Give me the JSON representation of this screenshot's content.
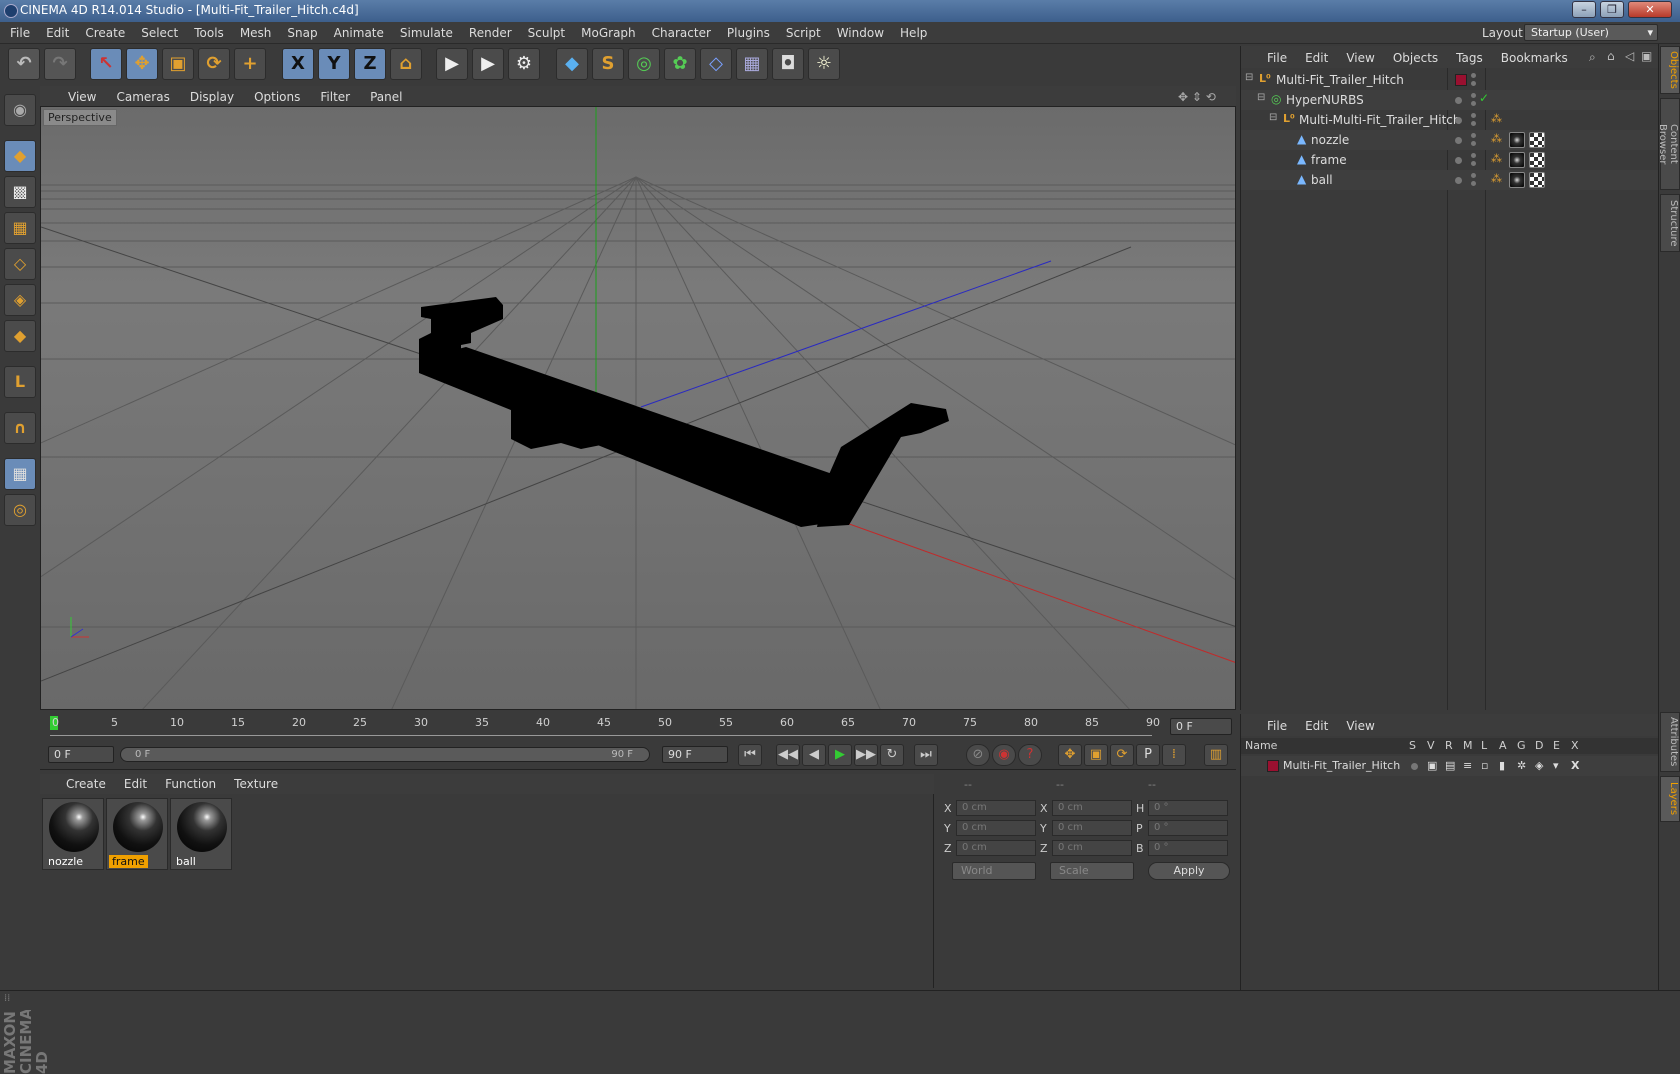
{
  "window": {
    "title": "CINEMA 4D R14.014 Studio - [Multi-Fit_Trailer_Hitch.c4d]",
    "min": "–",
    "max": "❐",
    "close": "✕"
  },
  "menubar": {
    "items": [
      "File",
      "Edit",
      "Create",
      "Select",
      "Tools",
      "Mesh",
      "Snap",
      "Animate",
      "Simulate",
      "Render",
      "Sculpt",
      "MoGraph",
      "Character",
      "Plugins",
      "Script",
      "Window",
      "Help"
    ],
    "layout_label": "Layout:",
    "layout_value": "Startup (User)"
  },
  "toolbar": {
    "undo": "↶",
    "redo": "↷",
    "live_select": "↖",
    "move": "✥",
    "scale": "▣",
    "rotate": "⟳",
    "last_tool": "+",
    "x_axis": "X",
    "y_axis": "Y",
    "z_axis": "Z",
    "coord_system": "⌂",
    "render_view": "▶",
    "render_pic": "▶",
    "render_settings": "⚙",
    "cube": "◆",
    "spline": "S",
    "nurbs": "◎",
    "array": "✿",
    "deformer": "◇",
    "floor": "▦",
    "camera": "◘",
    "light": "☼"
  },
  "lefttools": {
    "items": [
      "◉",
      "◆",
      "▩",
      "▦",
      "◇",
      "◈",
      "◆",
      "L",
      "∩",
      "▦",
      "◎"
    ]
  },
  "viewport": {
    "menu": [
      "View",
      "Cameras",
      "Display",
      "Options",
      "Filter",
      "Panel"
    ],
    "label": "Perspective"
  },
  "timeline": {
    "ticks": [
      "0",
      "5",
      "10",
      "15",
      "20",
      "25",
      "30",
      "35",
      "40",
      "45",
      "50",
      "55",
      "60",
      "65",
      "70",
      "75",
      "80",
      "85",
      "90"
    ],
    "current_frame": "0 F"
  },
  "transport": {
    "start_field": "0 F",
    "range_start": "0 F",
    "range_end": "90 F",
    "end_field": "90 F",
    "buttons": [
      "⏮",
      "◀◀",
      "◀",
      "▶",
      "▶▶",
      "↻",
      "⏭"
    ]
  },
  "materials": {
    "menu": [
      "Create",
      "Edit",
      "Function",
      "Texture"
    ],
    "items": [
      {
        "name": "nozzle",
        "selected": false
      },
      {
        "name": "frame",
        "selected": true
      },
      {
        "name": "ball",
        "selected": false
      }
    ]
  },
  "coords": {
    "headers": [
      "--",
      "--",
      "--"
    ],
    "rows": [
      {
        "a": "X",
        "av": "0 cm",
        "b": "X",
        "bv": "0 cm",
        "c": "H",
        "cv": "0 °"
      },
      {
        "a": "Y",
        "av": "0 cm",
        "b": "Y",
        "bv": "0 cm",
        "c": "P",
        "cv": "0 °"
      },
      {
        "a": "Z",
        "av": "0 cm",
        "b": "Z",
        "bv": "0 cm",
        "c": "B",
        "cv": "0 °"
      }
    ],
    "mode": "World",
    "scale": "Scale",
    "apply": "Apply"
  },
  "objects": {
    "menu": [
      "File",
      "Edit",
      "View",
      "Objects",
      "Tags",
      "Bookmarks"
    ],
    "rows": [
      {
        "name": "Multi-Fit_Trailer_Hitch"
      },
      {
        "name": "HyperNURBS"
      },
      {
        "name": "Multi-Multi-Fit_Trailer_Hitch"
      },
      {
        "name": "nozzle"
      },
      {
        "name": "frame"
      },
      {
        "name": "ball"
      }
    ]
  },
  "layers": {
    "menu": [
      "File",
      "Edit",
      "View"
    ],
    "columns": [
      "Name",
      "S",
      "V",
      "R",
      "M",
      "L",
      "A",
      "G",
      "D",
      "E",
      "X"
    ],
    "rows": [
      {
        "name": "Multi-Fit_Trailer_Hitch"
      }
    ]
  },
  "sidetabs": [
    "Objects",
    "Content Browser",
    "Structure",
    "Attributes",
    "Layers"
  ],
  "brand": "MAXON CINEMA 4D",
  "colors": {
    "accent": "#f0a000",
    "selection": "#6a8cb8",
    "layer_color": "#9a1030"
  }
}
